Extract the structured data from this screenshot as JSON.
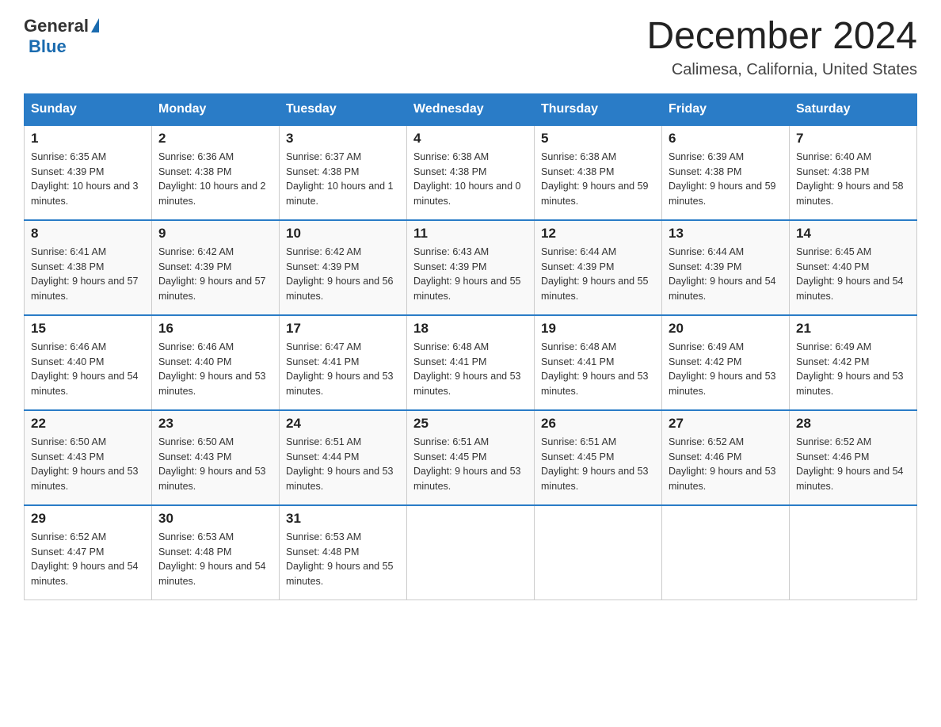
{
  "header": {
    "logo_general": "General",
    "logo_blue": "Blue",
    "month_title": "December 2024",
    "location": "Calimesa, California, United States"
  },
  "days_of_week": [
    "Sunday",
    "Monday",
    "Tuesday",
    "Wednesday",
    "Thursday",
    "Friday",
    "Saturday"
  ],
  "weeks": [
    [
      {
        "num": "1",
        "sunrise": "6:35 AM",
        "sunset": "4:39 PM",
        "daylight": "10 hours and 3 minutes."
      },
      {
        "num": "2",
        "sunrise": "6:36 AM",
        "sunset": "4:38 PM",
        "daylight": "10 hours and 2 minutes."
      },
      {
        "num": "3",
        "sunrise": "6:37 AM",
        "sunset": "4:38 PM",
        "daylight": "10 hours and 1 minute."
      },
      {
        "num": "4",
        "sunrise": "6:38 AM",
        "sunset": "4:38 PM",
        "daylight": "10 hours and 0 minutes."
      },
      {
        "num": "5",
        "sunrise": "6:38 AM",
        "sunset": "4:38 PM",
        "daylight": "9 hours and 59 minutes."
      },
      {
        "num": "6",
        "sunrise": "6:39 AM",
        "sunset": "4:38 PM",
        "daylight": "9 hours and 59 minutes."
      },
      {
        "num": "7",
        "sunrise": "6:40 AM",
        "sunset": "4:38 PM",
        "daylight": "9 hours and 58 minutes."
      }
    ],
    [
      {
        "num": "8",
        "sunrise": "6:41 AM",
        "sunset": "4:38 PM",
        "daylight": "9 hours and 57 minutes."
      },
      {
        "num": "9",
        "sunrise": "6:42 AM",
        "sunset": "4:39 PM",
        "daylight": "9 hours and 57 minutes."
      },
      {
        "num": "10",
        "sunrise": "6:42 AM",
        "sunset": "4:39 PM",
        "daylight": "9 hours and 56 minutes."
      },
      {
        "num": "11",
        "sunrise": "6:43 AM",
        "sunset": "4:39 PM",
        "daylight": "9 hours and 55 minutes."
      },
      {
        "num": "12",
        "sunrise": "6:44 AM",
        "sunset": "4:39 PM",
        "daylight": "9 hours and 55 minutes."
      },
      {
        "num": "13",
        "sunrise": "6:44 AM",
        "sunset": "4:39 PM",
        "daylight": "9 hours and 54 minutes."
      },
      {
        "num": "14",
        "sunrise": "6:45 AM",
        "sunset": "4:40 PM",
        "daylight": "9 hours and 54 minutes."
      }
    ],
    [
      {
        "num": "15",
        "sunrise": "6:46 AM",
        "sunset": "4:40 PM",
        "daylight": "9 hours and 54 minutes."
      },
      {
        "num": "16",
        "sunrise": "6:46 AM",
        "sunset": "4:40 PM",
        "daylight": "9 hours and 53 minutes."
      },
      {
        "num": "17",
        "sunrise": "6:47 AM",
        "sunset": "4:41 PM",
        "daylight": "9 hours and 53 minutes."
      },
      {
        "num": "18",
        "sunrise": "6:48 AM",
        "sunset": "4:41 PM",
        "daylight": "9 hours and 53 minutes."
      },
      {
        "num": "19",
        "sunrise": "6:48 AM",
        "sunset": "4:41 PM",
        "daylight": "9 hours and 53 minutes."
      },
      {
        "num": "20",
        "sunrise": "6:49 AM",
        "sunset": "4:42 PM",
        "daylight": "9 hours and 53 minutes."
      },
      {
        "num": "21",
        "sunrise": "6:49 AM",
        "sunset": "4:42 PM",
        "daylight": "9 hours and 53 minutes."
      }
    ],
    [
      {
        "num": "22",
        "sunrise": "6:50 AM",
        "sunset": "4:43 PM",
        "daylight": "9 hours and 53 minutes."
      },
      {
        "num": "23",
        "sunrise": "6:50 AM",
        "sunset": "4:43 PM",
        "daylight": "9 hours and 53 minutes."
      },
      {
        "num": "24",
        "sunrise": "6:51 AM",
        "sunset": "4:44 PM",
        "daylight": "9 hours and 53 minutes."
      },
      {
        "num": "25",
        "sunrise": "6:51 AM",
        "sunset": "4:45 PM",
        "daylight": "9 hours and 53 minutes."
      },
      {
        "num": "26",
        "sunrise": "6:51 AM",
        "sunset": "4:45 PM",
        "daylight": "9 hours and 53 minutes."
      },
      {
        "num": "27",
        "sunrise": "6:52 AM",
        "sunset": "4:46 PM",
        "daylight": "9 hours and 53 minutes."
      },
      {
        "num": "28",
        "sunrise": "6:52 AM",
        "sunset": "4:46 PM",
        "daylight": "9 hours and 54 minutes."
      }
    ],
    [
      {
        "num": "29",
        "sunrise": "6:52 AM",
        "sunset": "4:47 PM",
        "daylight": "9 hours and 54 minutes."
      },
      {
        "num": "30",
        "sunrise": "6:53 AM",
        "sunset": "4:48 PM",
        "daylight": "9 hours and 54 minutes."
      },
      {
        "num": "31",
        "sunrise": "6:53 AM",
        "sunset": "4:48 PM",
        "daylight": "9 hours and 55 minutes."
      },
      null,
      null,
      null,
      null
    ]
  ]
}
